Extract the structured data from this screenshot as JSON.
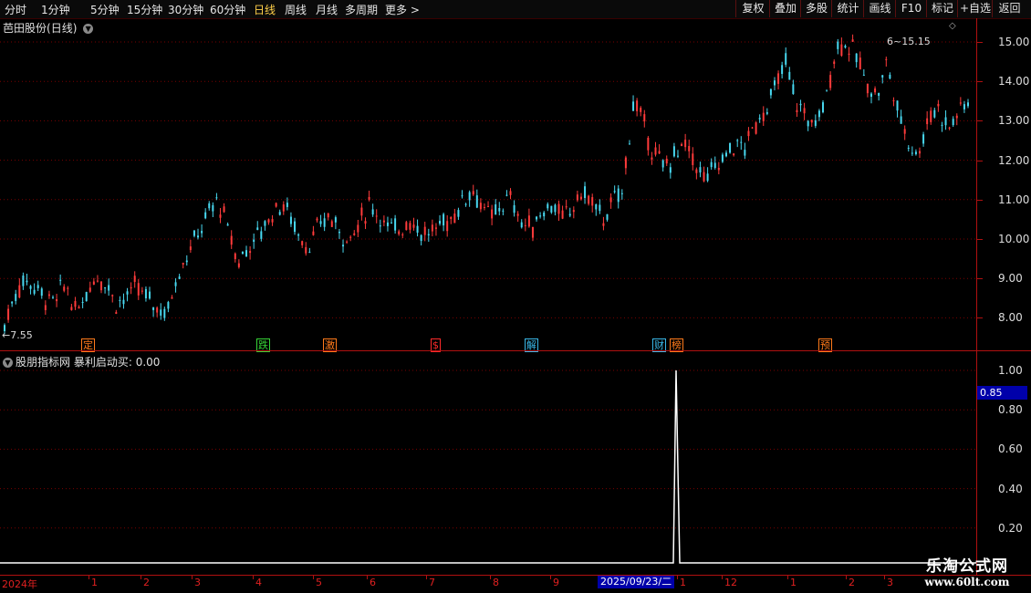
{
  "toolbar": {
    "periods": [
      "分时",
      "1分钟",
      "5分钟",
      "15分钟",
      "30分钟",
      "60分钟",
      "日线",
      "周线",
      "月线",
      "多周期",
      "更多 >"
    ],
    "active_period": "日线",
    "right_buttons": [
      "复权",
      "叠加",
      "多股",
      "统计",
      "画线",
      "F10",
      "标记",
      "+自选",
      "返回"
    ]
  },
  "stock": {
    "name": "芭田股份",
    "period_label": "(日线)"
  },
  "indicator": {
    "name": "股朋指标网",
    "series_label": "暴利启动买:",
    "value": "0.00"
  },
  "price_axis": [
    "15.00",
    "14.00",
    "13.00",
    "12.00",
    "11.00",
    "10.00",
    "9.00",
    "8.00"
  ],
  "indicator_axis": [
    "1.00",
    "0.80",
    "0.60",
    "0.40",
    "0.20"
  ],
  "cursor_value": "0.85",
  "high_label": "15.15",
  "low_label": "7.55",
  "events": [
    {
      "label": "定",
      "color": "#ff7a1a"
    },
    {
      "label": "跌",
      "color": "#36d336"
    },
    {
      "label": "激",
      "color": "#ff7a1a"
    },
    {
      "label": "$",
      "color": "#ff2a2a"
    },
    {
      "label": "解",
      "color": "#3ab8e8"
    },
    {
      "label": "财",
      "color": "#3ab8e8"
    },
    {
      "label": "榜",
      "color": "#ff7a1a"
    },
    {
      "label": "预",
      "color": "#ff7a1a"
    }
  ],
  "date_axis": [
    "2024年",
    "1",
    "2",
    "3",
    "4",
    "5",
    "6",
    "7",
    "8",
    "9",
    "1",
    "12",
    "1",
    "2",
    "3"
  ],
  "cursor_date": "2025/09/23/二",
  "watermark": {
    "name": "乐淘公式网",
    "url": "www.60lt.com"
  },
  "colors": {
    "up": "#ff3b3b",
    "down": "#48d8f0",
    "grid": "#7a0000",
    "accent": "#ffd04a"
  },
  "chart_data": [
    {
      "type": "candlestick",
      "title": "芭田股份(日线)",
      "ylim": [
        7.4,
        15.4
      ],
      "high": 15.15,
      "low": 7.55,
      "close_path": [
        7.8,
        8.6,
        9.0,
        8.8,
        8.5,
        8.4,
        8.9,
        8.1,
        8.6,
        9.1,
        8.9,
        8.4,
        8.5,
        8.8,
        8.5,
        8.3,
        8.1,
        9.1,
        9.6,
        10.1,
        10.6,
        11.0,
        10.3,
        9.4,
        9.8,
        10.1,
        10.5,
        10.9,
        10.7,
        10.1,
        9.8,
        10.3,
        10.6,
        10.2,
        10.0,
        10.4,
        10.9,
        10.6,
        10.2,
        10.3,
        10.5,
        10.2,
        10.1,
        10.4,
        10.5,
        10.9,
        11.3,
        10.9,
        10.5,
        10.9,
        11.0,
        10.4,
        10.3,
        10.7,
        10.9,
        10.5,
        10.8,
        11.2,
        10.9,
        10.5,
        10.9,
        11.3,
        13.5,
        12.9,
        12.2,
        11.8,
        12.1,
        12.4,
        12.0,
        11.5,
        11.8,
        12.1,
        12.4,
        12.3,
        12.9,
        13.3,
        13.8,
        14.5,
        13.5,
        13.1,
        12.9,
        13.6,
        14.9,
        15.0,
        14.6,
        14.0,
        13.6,
        14.5,
        13.3,
        12.6,
        12.1,
        13.0,
        13.4,
        12.8,
        13.2,
        13.5
      ]
    },
    {
      "type": "line",
      "title": "股朋指标网",
      "series": [
        {
          "name": "暴利启动买:",
          "values": [
            0,
            1,
            0.5,
            0
          ]
        }
      ],
      "ylim": [
        0,
        1.05
      ]
    }
  ]
}
